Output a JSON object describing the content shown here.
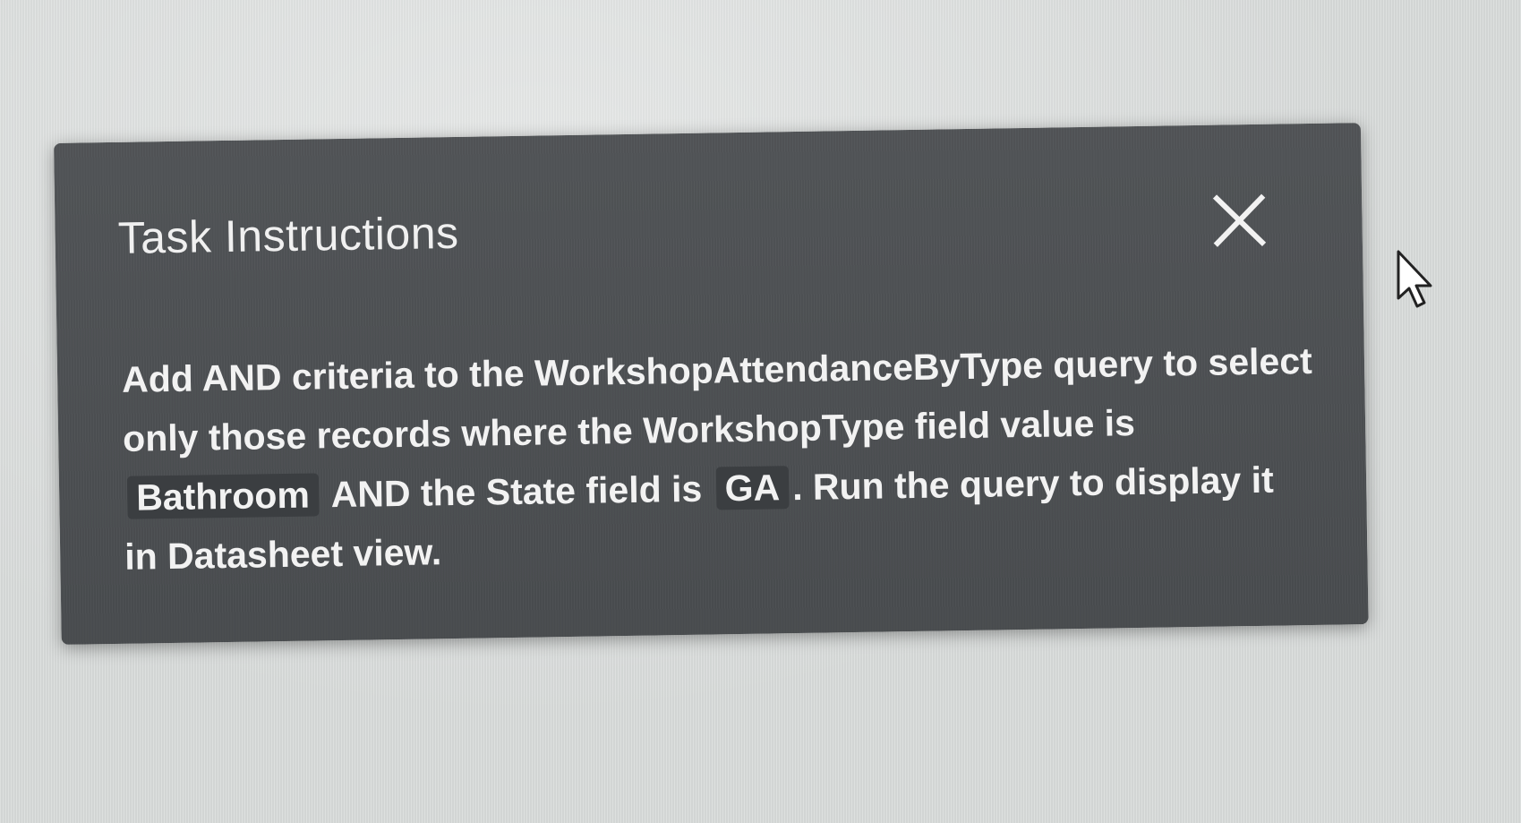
{
  "dialog": {
    "title": "Task Instructions",
    "close_icon": "close-icon",
    "instructions": {
      "part1": "Add AND criteria to the WorkshopAttendanceByType query to select only those records where the WorkshopType field value is",
      "value1": "Bathroom",
      "part2": "AND the State field is",
      "value2": "GA",
      "part3": ". Run the query to display it in Datasheet view."
    }
  },
  "cursor_icon": "mouse-pointer-icon",
  "colors": {
    "panel_background": "#4a4d50",
    "text": "#f2f2f2",
    "chip_background": "#3b3e41",
    "page_background": "#d9dcdb"
  }
}
